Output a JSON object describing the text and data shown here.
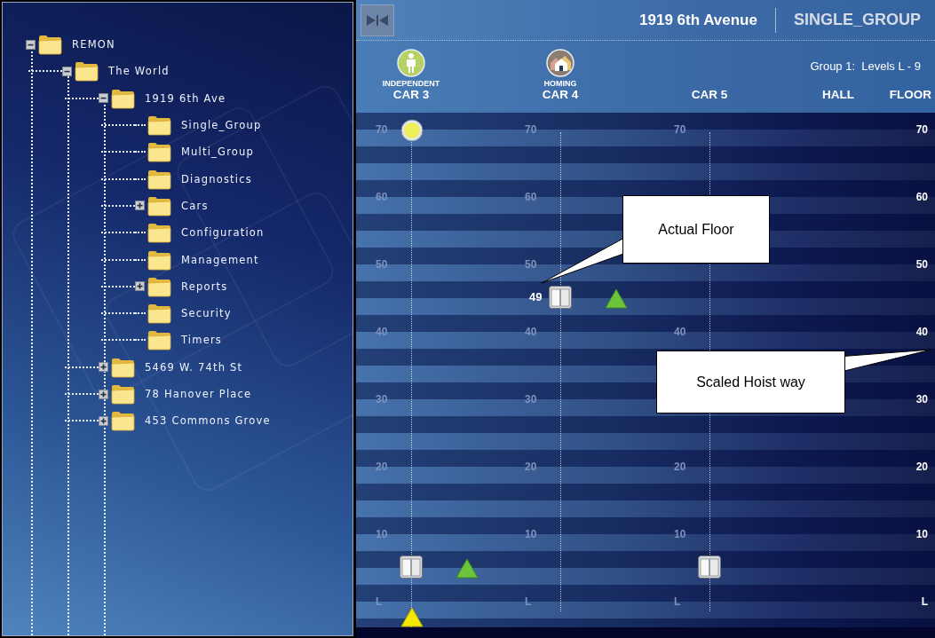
{
  "tree": [
    {
      "label": "REMON",
      "expanded": true,
      "children": [
        {
          "label": "The World",
          "expanded": true,
          "children": [
            {
              "label": "1919 6th Ave",
              "expanded": true,
              "children": [
                {
                  "label": "Single_Group"
                },
                {
                  "label": "Multi_Group"
                },
                {
                  "label": "Diagnostics"
                },
                {
                  "label": "Cars",
                  "expanded": false
                },
                {
                  "label": "Configuration"
                },
                {
                  "label": "Management"
                },
                {
                  "label": "Reports",
                  "expanded": false
                },
                {
                  "label": "Security"
                },
                {
                  "label": "Timers"
                }
              ]
            },
            {
              "label": "5469 W. 74th St",
              "expanded": false
            },
            {
              "label": "78 Hanover Place",
              "expanded": false
            },
            {
              "label": "453 Commons Grove",
              "expanded": false
            }
          ]
        }
      ]
    }
  ],
  "header": {
    "building": "1919 6th Avenue",
    "group": "SINGLE_GROUP"
  },
  "group_info": "Group 1:  Levels L - 9",
  "cars": [
    {
      "label": "CAR 3",
      "mode": "INDEPENDENT",
      "kind": "independent"
    },
    {
      "label": "CAR 4",
      "mode": "HOMING",
      "kind": "homing"
    },
    {
      "label": "CAR 5"
    }
  ],
  "columns": {
    "hall": "HALL",
    "floor": "FLOOR"
  },
  "rows": [
    {
      "floor": "70",
      "cells": [
        {
          "label": "70",
          "marks": [
            {
              "kind": "car-call"
            }
          ]
        },
        {
          "label": "70"
        },
        {
          "label": "70"
        }
      ]
    },
    {
      "floor": "60",
      "cells": [
        {
          "label": "60"
        },
        {
          "label": "60"
        },
        {}
      ]
    },
    {
      "floor": "50",
      "cells": [
        {
          "label": "50"
        },
        {
          "label": "50"
        },
        {}
      ]
    },
    {
      "floor": "40",
      "cells": [
        {
          "label": "40"
        },
        {
          "label": "40",
          "marks": [
            {
              "kind": "car",
              "floor": "49"
            },
            {
              "kind": "up-arrow"
            }
          ]
        },
        {
          "label": "40"
        }
      ]
    },
    {
      "floor": "30",
      "cells": [
        {
          "label": "30"
        },
        {
          "label": "30"
        },
        {}
      ]
    },
    {
      "floor": "20",
      "cells": [
        {
          "label": "20"
        },
        {
          "label": "20"
        },
        {
          "label": "20"
        }
      ]
    },
    {
      "floor": "10",
      "cells": [
        {
          "label": "10"
        },
        {
          "label": "10"
        },
        {
          "label": "10"
        }
      ]
    },
    {
      "floor": "L",
      "cells": [
        {
          "label": "L",
          "marks": [
            {
              "kind": "car"
            },
            {
              "kind": "up-arrow"
            },
            {
              "kind": "position"
            }
          ]
        },
        {
          "label": "L"
        },
        {
          "label": "L",
          "marks": [
            {
              "kind": "car"
            }
          ]
        }
      ]
    }
  ],
  "callouts": [
    {
      "text": "Actual Floor",
      "kind": "car"
    },
    {
      "text": "Scaled Hoist way",
      "kind": "scale"
    }
  ]
}
